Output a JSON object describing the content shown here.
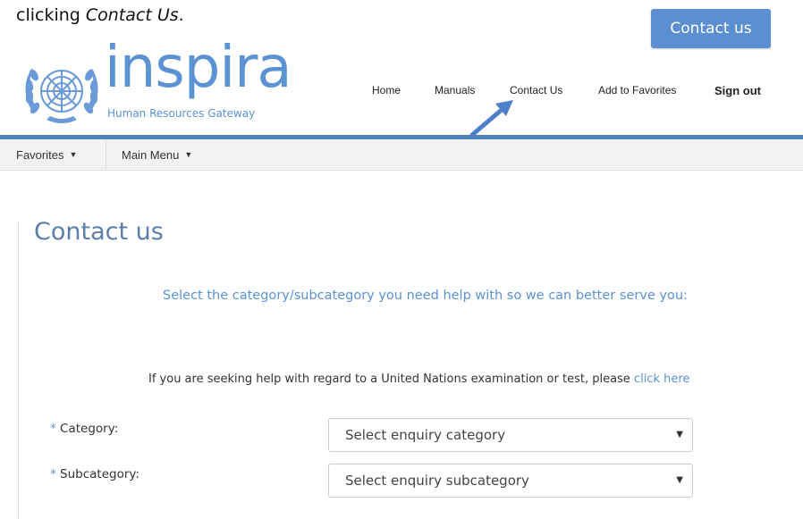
{
  "intro": {
    "prefix": "clicking ",
    "emphasis": "Contact Us",
    "suffix": "."
  },
  "top_button": {
    "label": "Contact us"
  },
  "logo": {
    "word": "inspira",
    "subtitle": "Human Resources Gateway"
  },
  "nav": {
    "items": [
      "Home",
      "Manuals",
      "Contact Us",
      "Add to Favorites"
    ],
    "sign_out": "Sign out"
  },
  "menubar": {
    "favorites": "Favorites",
    "main_menu": "Main Menu"
  },
  "page": {
    "title": "Contact us",
    "lead": "Select the category/subcategory you need help with so we can better serve you:",
    "exam_text": "If you are seeking help with regard to a United Nations examination or test, please ",
    "exam_link": "click here"
  },
  "form": {
    "required_mark": "*",
    "category_label": "Category:",
    "subcategory_label": "Subcategory:",
    "category_value": "Select enquiry category",
    "subcategory_value": "Select enquiry subcategory"
  },
  "colors": {
    "accent": "#5b92d3",
    "bar": "#4f7fbd",
    "button": "#5b8fd0"
  }
}
